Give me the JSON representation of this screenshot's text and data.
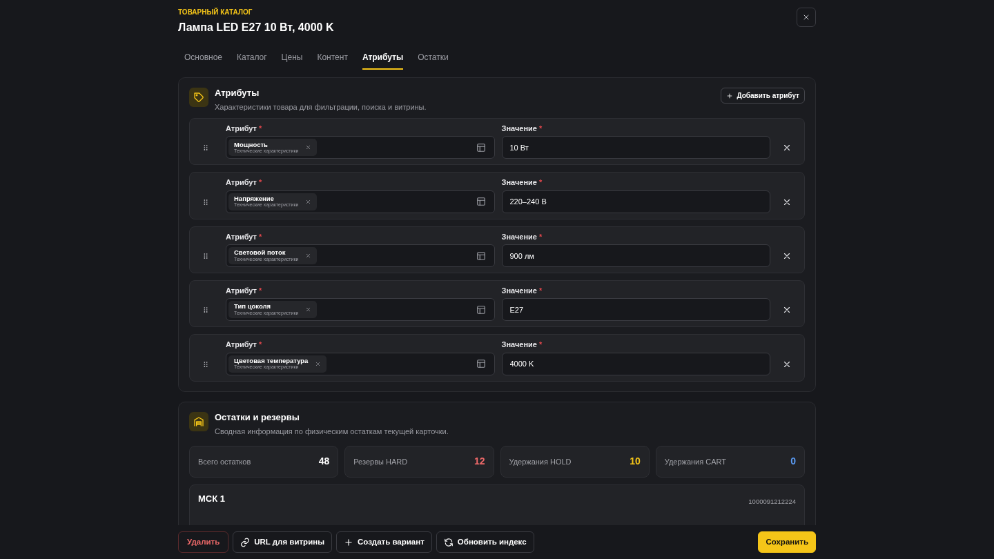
{
  "header": {
    "eyebrow": "ТОВАРНЫЙ КАТАЛОГ",
    "title": "Лампа LED E27 10 Вт, 4000 K"
  },
  "tabs": [
    {
      "label": "Основное",
      "selected": false
    },
    {
      "label": "Каталог",
      "selected": false
    },
    {
      "label": "Цены",
      "selected": false
    },
    {
      "label": "Контент",
      "selected": false
    },
    {
      "label": "Атрибуты",
      "selected": true
    },
    {
      "label": "Остатки",
      "selected": false
    }
  ],
  "attributes_section": {
    "title": "Атрибуты",
    "subtitle": "Характеристики товара для фильтрации, поиска и витрины.",
    "add_button": "Добавить атрибут",
    "rows": [
      {
        "attribute_label": "Атрибут",
        "attribute_mark": "*",
        "attribute": "Мощность",
        "group": "Технические характеристики",
        "value_label": "Значение",
        "value_mark": "*",
        "value": "10 Вт"
      },
      {
        "attribute_label": "Атрибут",
        "attribute_mark": "*",
        "attribute": "Напряжение",
        "group": "Технические характеристики",
        "value_label": "Значение",
        "value_mark": "*",
        "value": "220–240 В"
      },
      {
        "attribute_label": "Атрибут",
        "attribute_mark": "*",
        "attribute": "Световой поток",
        "group": "Технические характеристики",
        "value_label": "Значение",
        "value_mark": "*",
        "value": "900 лм"
      },
      {
        "attribute_label": "Атрибут",
        "attribute_mark": "*",
        "attribute": "Тип цоколя",
        "group": "Технические характеристики",
        "value_label": "Значение",
        "value_mark": "*",
        "value": "E27"
      },
      {
        "attribute_label": "Атрибут",
        "attribute_mark": "*",
        "attribute": "Цветовая температура",
        "group": "Технические характеристики",
        "value_label": "Значение",
        "value_mark": "*",
        "value": "4000 K"
      }
    ]
  },
  "stock_section": {
    "title": "Остатки и резервы",
    "subtitle": "Сводная информация по физическим остаткам текущей карточки.",
    "stats": [
      {
        "label": "Всего остатков",
        "value": "48",
        "color": "#ffffff"
      },
      {
        "label": "Резервы HARD",
        "value": "12",
        "color": "#f06a6a"
      },
      {
        "label": "Удержания HOLD",
        "value": "10",
        "color": "#f5c518"
      },
      {
        "label": "Удержания CART",
        "value": "0",
        "color": "#5b9cf5"
      }
    ],
    "warehouse": {
      "name": "МСК 1",
      "code": "1000091212224"
    }
  },
  "footer": {
    "delete": "Удалить",
    "url": "URL для витрины",
    "create_variant": "Создать вариант",
    "reindex": "Обновить индекс",
    "save": "Сохранить"
  }
}
